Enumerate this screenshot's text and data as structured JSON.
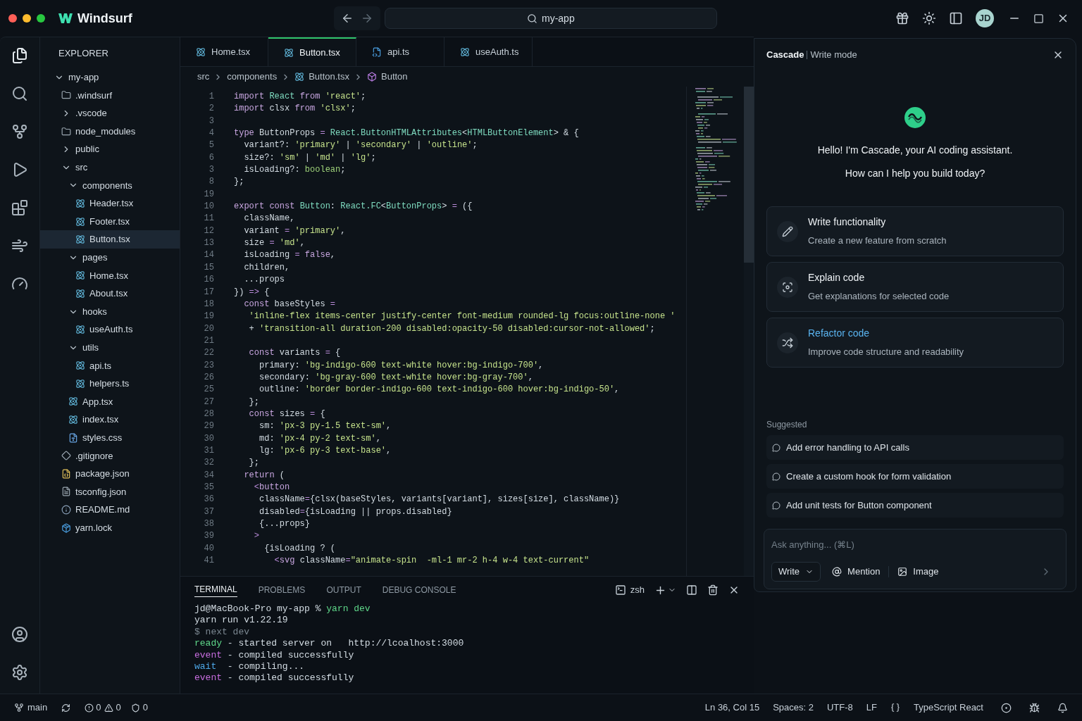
{
  "app": {
    "name": "Windsurf",
    "search": "my-app",
    "avatar": "JD"
  },
  "explorer": {
    "title": "EXPLORER",
    "tree": [
      {
        "label": "my-app",
        "kind": "folder",
        "expanded": true,
        "selected": false,
        "children": [
          {
            "label": ".windsurf",
            "kind": "folder-plain",
            "selected": false
          },
          {
            "label": ".vscode",
            "kind": "folder",
            "expanded": false,
            "selected": false
          },
          {
            "label": "node_modules",
            "kind": "folder-plain",
            "selected": false
          },
          {
            "label": "public",
            "kind": "folder",
            "expanded": false,
            "selected": false
          },
          {
            "label": "src",
            "kind": "folder",
            "expanded": true,
            "selected": false,
            "children": [
              {
                "label": "components",
                "kind": "folder",
                "expanded": true,
                "selected": false,
                "children": [
                  {
                    "label": "Header.tsx",
                    "kind": "react",
                    "selected": false
                  },
                  {
                    "label": "Footer.tsx",
                    "kind": "react",
                    "selected": false
                  },
                  {
                    "label": "Button.tsx",
                    "kind": "react",
                    "selected": true
                  }
                ]
              },
              {
                "label": "pages",
                "kind": "folder",
                "expanded": true,
                "selected": false,
                "children": [
                  {
                    "label": "Home.tsx",
                    "kind": "react",
                    "selected": false
                  },
                  {
                    "label": "About.tsx",
                    "kind": "react",
                    "selected": false
                  }
                ]
              },
              {
                "label": "hooks",
                "kind": "folder",
                "expanded": true,
                "selected": false,
                "children": [
                  {
                    "label": "useAuth.ts",
                    "kind": "react",
                    "selected": false
                  }
                ]
              },
              {
                "label": "utils",
                "kind": "folder",
                "expanded": true,
                "selected": false,
                "children": [
                  {
                    "label": "api.ts",
                    "kind": "react",
                    "selected": false
                  },
                  {
                    "label": "helpers.ts",
                    "kind": "react",
                    "selected": false
                  }
                ]
              },
              {
                "label": "App.tsx",
                "kind": "react",
                "selected": false
              },
              {
                "label": "index.tsx",
                "kind": "react",
                "selected": false
              },
              {
                "label": "styles.css",
                "kind": "css",
                "selected": false
              }
            ]
          },
          {
            "label": ".gitignore",
            "kind": "git",
            "selected": false
          },
          {
            "label": "package.json",
            "kind": "json",
            "selected": false
          },
          {
            "label": "tsconfig.json",
            "kind": "file",
            "selected": false
          },
          {
            "label": "README.md",
            "kind": "info",
            "selected": false
          },
          {
            "label": "yarn.lock",
            "kind": "yarn",
            "selected": false
          }
        ]
      }
    ]
  },
  "tabs": [
    {
      "label": "Home.tsx",
      "kind": "react",
      "selected": false
    },
    {
      "label": "Button.tsx",
      "kind": "react",
      "selected": true
    },
    {
      "label": "api.ts",
      "kind": "ts",
      "selected": false
    },
    {
      "label": "useAuth.ts",
      "kind": "react",
      "selected": false
    }
  ],
  "breadcrumbs": [
    {
      "label": "src",
      "kind": "folder"
    },
    {
      "label": "components",
      "kind": "folder"
    },
    {
      "label": "Button.tsx",
      "kind": "react"
    },
    {
      "label": "Button",
      "kind": "symbol"
    }
  ],
  "code": [
    {
      "n": "1",
      "t": [
        {
          "kind": "k",
          "text": "import "
        },
        {
          "kind": "i",
          "text": "React "
        },
        {
          "kind": "k",
          "text": "from "
        },
        {
          "kind": "s",
          "text": "'react'"
        },
        {
          "kind": "p",
          "text": ";"
        }
      ]
    },
    {
      "n": "2",
      "t": [
        {
          "kind": "k",
          "text": "import "
        },
        {
          "kind": "p",
          "text": "clsx "
        },
        {
          "kind": "k",
          "text": "from "
        },
        {
          "kind": "s",
          "text": "'clsx'"
        },
        {
          "kind": "p",
          "text": ";"
        }
      ]
    },
    {
      "n": "3"
    },
    {
      "n": "4",
      "t": [
        {
          "kind": "k",
          "text": "type "
        },
        {
          "kind": "p",
          "text": "ButtonProps "
        },
        {
          "kind": "o",
          "text": "= "
        },
        {
          "kind": "i",
          "text": "React.ButtonHTMLAttributes"
        },
        {
          "kind": "p",
          "text": "<"
        },
        {
          "kind": "i",
          "text": "HTMLButtonElement"
        },
        {
          "kind": "p",
          "text": "> & {"
        }
      ]
    },
    {
      "n": "5",
      "t": [
        {
          "kind": "p",
          "text": "  variant?: "
        },
        {
          "kind": "s",
          "text": "'primary'"
        },
        {
          "kind": "p",
          "text": " | "
        },
        {
          "kind": "s",
          "text": "'secondary'"
        },
        {
          "kind": "p",
          "text": " | "
        },
        {
          "kind": "s",
          "text": "'outline'"
        },
        {
          "kind": "p",
          "text": ";"
        }
      ]
    },
    {
      "n": "6",
      "t": [
        {
          "kind": "p",
          "text": "  size?: "
        },
        {
          "kind": "s",
          "text": "'sm'"
        },
        {
          "kind": "p",
          "text": " | "
        },
        {
          "kind": "s",
          "text": "'md'"
        },
        {
          "kind": "p",
          "text": " | "
        },
        {
          "kind": "s",
          "text": "'lg'"
        },
        {
          "kind": "p",
          "text": ";"
        }
      ]
    },
    {
      "n": "3",
      "t": [
        {
          "kind": "p",
          "text": "  isLoading?: "
        },
        {
          "kind": "b",
          "text": "boolean"
        },
        {
          "kind": "p",
          "text": ";"
        }
      ]
    },
    {
      "n": "8",
      "t": [
        {
          "kind": "p",
          "text": "};"
        }
      ]
    },
    {
      "n": "19"
    },
    {
      "n": "10",
      "t": [
        {
          "kind": "k",
          "text": "export const "
        },
        {
          "kind": "i",
          "text": "Button"
        },
        {
          "kind": "p",
          "text": ": "
        },
        {
          "kind": "i",
          "text": "React.FC"
        },
        {
          "kind": "p",
          "text": "<"
        },
        {
          "kind": "i",
          "text": "ButtonProps"
        },
        {
          "kind": "p",
          "text": "> "
        },
        {
          "kind": "o",
          "text": "= "
        },
        {
          "kind": "p",
          "text": "({"
        }
      ]
    },
    {
      "n": "11",
      "t": [
        {
          "kind": "p",
          "text": "  className,"
        }
      ]
    },
    {
      "n": "12",
      "t": [
        {
          "kind": "p",
          "text": "  variant "
        },
        {
          "kind": "o",
          "text": "= "
        },
        {
          "kind": "s",
          "text": "'primary'"
        },
        {
          "kind": "p",
          "text": ","
        }
      ]
    },
    {
      "n": "13",
      "t": [
        {
          "kind": "p",
          "text": "  size "
        },
        {
          "kind": "o",
          "text": "= "
        },
        {
          "kind": "s",
          "text": "'md'"
        },
        {
          "kind": "p",
          "text": ","
        }
      ]
    },
    {
      "n": "14",
      "t": [
        {
          "kind": "p",
          "text": "  isLoading "
        },
        {
          "kind": "o",
          "text": "= "
        },
        {
          "kind": "k",
          "text": "false"
        },
        {
          "kind": "p",
          "text": ","
        }
      ]
    },
    {
      "n": "15",
      "t": [
        {
          "kind": "p",
          "text": "  children,"
        }
      ]
    },
    {
      "n": "16",
      "t": [
        {
          "kind": "p",
          "text": "  ...props"
        }
      ]
    },
    {
      "n": "17",
      "t": [
        {
          "kind": "p",
          "text": "}) "
        },
        {
          "kind": "o",
          "text": "=> "
        },
        {
          "kind": "p",
          "text": "{"
        }
      ]
    },
    {
      "n": "18",
      "t": [
        {
          "kind": "k",
          "text": "  const "
        },
        {
          "kind": "p",
          "text": "baseStyles "
        },
        {
          "kind": "o",
          "text": "="
        }
      ]
    },
    {
      "n": "19",
      "t": [
        {
          "kind": "s",
          "text": "   'inline-flex items-center justify-center font-medium rounded-lg focus:outline-none '"
        }
      ]
    },
    {
      "n": "20",
      "t": [
        {
          "kind": "p",
          "text": "   + "
        },
        {
          "kind": "s",
          "text": "'transition-all duration-200 disabled:opacity-50 disabled:cursor-not-allowed'"
        },
        {
          "kind": "p",
          "text": ";"
        }
      ]
    },
    {
      "n": "21"
    },
    {
      "n": "22",
      "t": [
        {
          "kind": "k",
          "text": "   const "
        },
        {
          "kind": "p",
          "text": "variants "
        },
        {
          "kind": "o",
          "text": "= "
        },
        {
          "kind": "p",
          "text": "{"
        }
      ]
    },
    {
      "n": "23",
      "t": [
        {
          "kind": "p",
          "text": "     primary: "
        },
        {
          "kind": "s",
          "text": "'bg-indigo-600 text-white hover:bg-indigo-700'"
        },
        {
          "kind": "p",
          "text": ","
        }
      ]
    },
    {
      "n": "26",
      "t": [
        {
          "kind": "p",
          "text": "     secondary: "
        },
        {
          "kind": "s",
          "text": "'bg-gray-600 text-white hover:bg-gray-700'"
        },
        {
          "kind": "p",
          "text": ","
        }
      ]
    },
    {
      "n": "25",
      "t": [
        {
          "kind": "p",
          "text": "     outline: "
        },
        {
          "kind": "s",
          "text": "'border border-indigo-600 text-indigo-600 hover:bg-indigo-50'"
        },
        {
          "kind": "p",
          "text": ","
        }
      ]
    },
    {
      "n": "27",
      "t": [
        {
          "kind": "p",
          "text": "   };"
        }
      ]
    },
    {
      "n": "28",
      "t": [
        {
          "kind": "k",
          "text": "   const "
        },
        {
          "kind": "p",
          "text": "sizes "
        },
        {
          "kind": "o",
          "text": "= "
        },
        {
          "kind": "p",
          "text": "{"
        }
      ]
    },
    {
      "n": "29",
      "t": [
        {
          "kind": "p",
          "text": "     sm: "
        },
        {
          "kind": "s",
          "text": "'px-3 py-1.5 text-sm'"
        },
        {
          "kind": "p",
          "text": ","
        }
      ]
    },
    {
      "n": "30",
      "t": [
        {
          "kind": "p",
          "text": "     md: "
        },
        {
          "kind": "s",
          "text": "'px-4 py-2 text-sm'"
        },
        {
          "kind": "p",
          "text": ","
        }
      ]
    },
    {
      "n": "31",
      "t": [
        {
          "kind": "p",
          "text": "     lg: "
        },
        {
          "kind": "s",
          "text": "'px-6 py-3 text-base'"
        },
        {
          "kind": "p",
          "text": ","
        }
      ]
    },
    {
      "n": "32",
      "t": [
        {
          "kind": "p",
          "text": "   };"
        }
      ]
    },
    {
      "n": "34",
      "t": [
        {
          "kind": "k",
          "text": "  return "
        },
        {
          "kind": "p",
          "text": "("
        }
      ]
    },
    {
      "n": "35",
      "t": [
        {
          "kind": "o",
          "text": "    <"
        },
        {
          "kind": "k",
          "text": "button"
        }
      ]
    },
    {
      "n": "36",
      "t": [
        {
          "kind": "p",
          "text": "     className"
        },
        {
          "kind": "o",
          "text": "="
        },
        {
          "kind": "p",
          "text": "{clsx(baseStyles, variants[variant], sizes[size], className)}"
        }
      ]
    },
    {
      "n": "37",
      "t": [
        {
          "kind": "p",
          "text": "     disabled"
        },
        {
          "kind": "o",
          "text": "="
        },
        {
          "kind": "p",
          "text": "{isLoading || props.disabled}"
        }
      ]
    },
    {
      "n": "38",
      "t": [
        {
          "kind": "p",
          "text": "     {...props}"
        }
      ]
    },
    {
      "n": "39",
      "t": [
        {
          "kind": "o",
          "text": "    >"
        }
      ]
    },
    {
      "n": "40",
      "t": [
        {
          "kind": "p",
          "text": "      {isLoading ? ("
        }
      ]
    },
    {
      "n": "41",
      "t": [
        {
          "kind": "o",
          "text": "        <"
        },
        {
          "kind": "k",
          "text": "svg "
        },
        {
          "kind": "p",
          "text": "className"
        },
        {
          "kind": "o",
          "text": "="
        },
        {
          "kind": "s",
          "text": "\"animate-spin  -ml-1 mr-2 h-4 w-4 text-current\""
        }
      ]
    }
  ],
  "panel": {
    "tabs": [
      {
        "label": "TERMINAL",
        "selected": true
      },
      {
        "label": "PROBLEMS",
        "selected": false
      },
      {
        "label": "OUTPUT",
        "selected": false
      },
      {
        "label": "DEBUG CONSOLE",
        "selected": false
      }
    ],
    "shell": "zsh",
    "lines": [
      [
        {
          "kind": "p",
          "text": "jd@MacBook-Pro my-app % "
        },
        {
          "kind": "g",
          "text": "yarn dev"
        }
      ],
      [
        {
          "kind": "p",
          "text": "yarn run v1.22.19"
        }
      ],
      [
        {
          "kind": "d",
          "text": "$ next dev"
        }
      ],
      [
        {
          "kind": "g",
          "text": "ready"
        },
        {
          "kind": "p",
          "text": " - started server on   http://lcoalhost:3000"
        }
      ],
      [
        {
          "kind": "m",
          "text": "event"
        },
        {
          "kind": "p",
          "text": " - compiled successfully"
        }
      ],
      [
        {
          "kind": "c",
          "text": "wait"
        },
        {
          "kind": "p",
          "text": "  - compiling..."
        }
      ],
      [
        {
          "kind": "m",
          "text": "event"
        },
        {
          "kind": "p",
          "text": " - compiled successfully"
        }
      ]
    ]
  },
  "cascade": {
    "title": "Cascade",
    "mode": "Write mode",
    "greeting": [
      "Hello! I'm Cascade, your AI coding assistant.",
      "How can I help you build today?"
    ],
    "actions": [
      {
        "title": "Write functionality",
        "description": "Create a new feature from scratch",
        "kind": "write",
        "selected": false
      },
      {
        "title": "Explain code",
        "description": "Get explanations for selected code",
        "kind": "explain",
        "selected": false
      },
      {
        "title": "Refactor code",
        "description": "Improve code structure and readability",
        "kind": "refactor",
        "selected": true
      }
    ],
    "suggested_label": "Suggested",
    "suggestions": [
      "Add error handling to API calls",
      "Create a custom hook for form validation",
      "Add unit tests for Button component"
    ],
    "input": {
      "placeholder": "Ask anything... (⌘L)",
      "mode": "Write",
      "mention": "Mention",
      "image": "Image"
    }
  },
  "status_bar": {
    "branch": "main",
    "errors": "0",
    "warnings": "0",
    "ports": "0",
    "position": "Ln 36, Col 15",
    "spaces": "Spaces: 2",
    "encoding": "UTF-8",
    "eol": "LF",
    "language": "TypeScript React"
  }
}
